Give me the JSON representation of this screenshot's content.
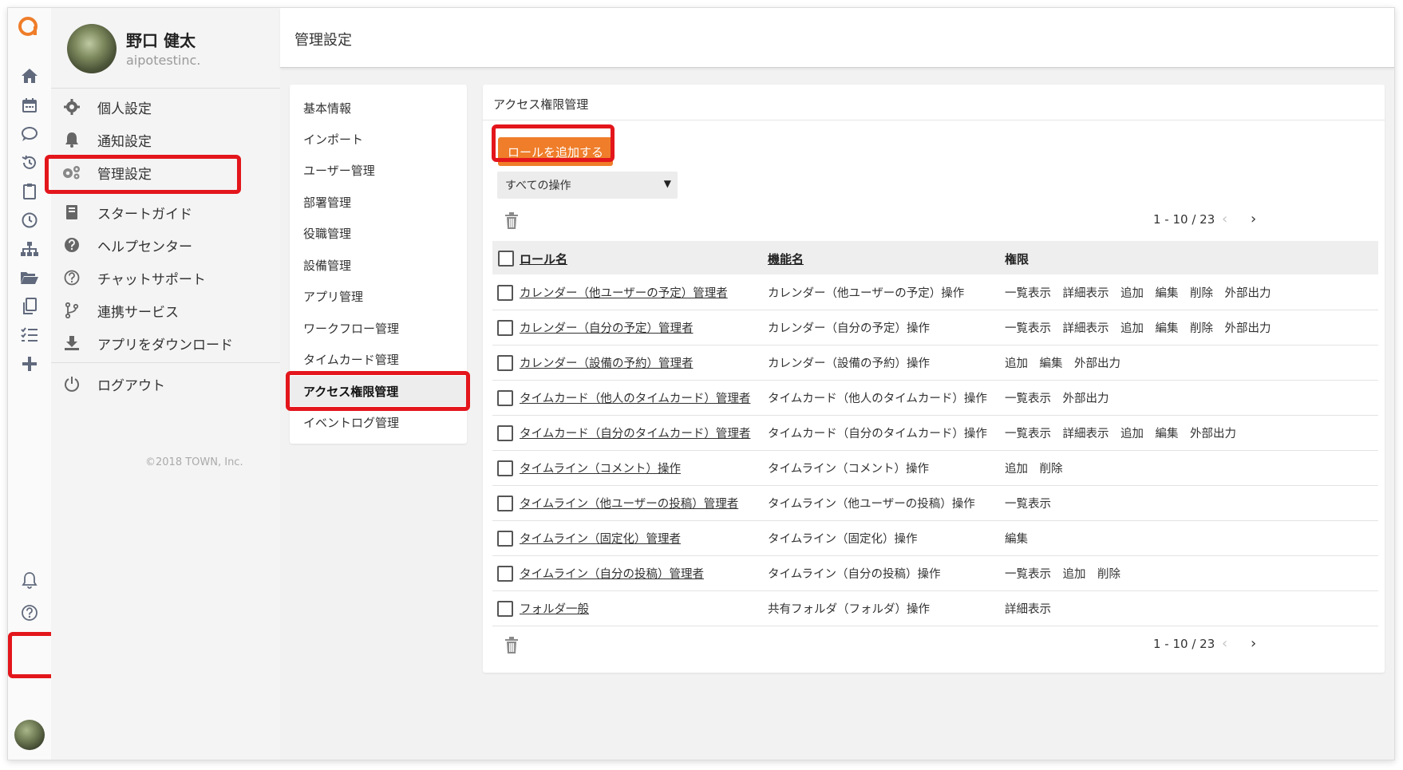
{
  "user": {
    "name": "野口 健太",
    "company": "aipotestinc."
  },
  "menu": [
    {
      "icon": "gear-icon",
      "label": "個人設定"
    },
    {
      "icon": "bell-icon",
      "label": "通知設定"
    },
    {
      "icon": "gears-icon",
      "label": "管理設定"
    },
    {
      "icon": "book-icon",
      "label": "スタートガイド"
    },
    {
      "icon": "question-circle-icon",
      "label": "ヘルプセンター"
    },
    {
      "icon": "question-outline-icon",
      "label": "チャットサポート"
    },
    {
      "icon": "branch-icon",
      "label": "連携サービス"
    },
    {
      "icon": "download-icon",
      "label": "アプリをダウンロード"
    },
    {
      "icon": "power-icon",
      "label": "ログアウト"
    }
  ],
  "copyright": "©2018 TOWN, Inc.",
  "header": {
    "title": "管理設定"
  },
  "settings_nav": [
    "基本情報",
    "インポート",
    "ユーザー管理",
    "部署管理",
    "役職管理",
    "設備管理",
    "アプリ管理",
    "ワークフロー管理",
    "タイムカード管理",
    "アクセス権限管理",
    "イベントログ管理"
  ],
  "settings_nav_active": "アクセス権限管理",
  "panel": {
    "title": "アクセス権限管理",
    "add_button": "ロールを追加する",
    "filter_selected": "すべての操作",
    "pagination": "1 - 10 / 23",
    "columns": {
      "role": "ロール名",
      "function": "機能名",
      "permission": "権限"
    },
    "rows": [
      {
        "role": "カレンダー（他ユーザーの予定）管理者",
        "function": "カレンダー（他ユーザーの予定）操作",
        "permission": "一覧表示　詳細表示　追加　編集　削除　外部出力"
      },
      {
        "role": "カレンダー（自分の予定）管理者",
        "function": "カレンダー（自分の予定）操作",
        "permission": "一覧表示　詳細表示　追加　編集　削除　外部出力"
      },
      {
        "role": "カレンダー（設備の予約）管理者",
        "function": "カレンダー（設備の予約）操作",
        "permission": "追加　編集　外部出力"
      },
      {
        "role": "タイムカード（他人のタイムカード）管理者",
        "function": "タイムカード（他人のタイムカード）操作",
        "permission": "一覧表示　外部出力"
      },
      {
        "role": "タイムカード（自分のタイムカード）管理者",
        "function": "タイムカード（自分のタイムカード）操作",
        "permission": "一覧表示　詳細表示　追加　編集　外部出力"
      },
      {
        "role": "タイムライン（コメント）操作",
        "function": "タイムライン（コメント）操作",
        "permission": "追加　削除"
      },
      {
        "role": "タイムライン（他ユーザーの投稿）管理者",
        "function": "タイムライン（他ユーザーの投稿）操作",
        "permission": "一覧表示"
      },
      {
        "role": "タイムライン（固定化）管理者",
        "function": "タイムライン（固定化）操作",
        "permission": "編集"
      },
      {
        "role": "タイムライン（自分の投稿）管理者",
        "function": "タイムライン（自分の投稿）操作",
        "permission": "一覧表示　追加　削除"
      },
      {
        "role": "フォルダ一般",
        "function": "共有フォルダ（フォルダ）操作",
        "permission": "詳細表示"
      }
    ]
  },
  "colors": {
    "accent": "#ef7d2a",
    "highlight": "#e3161c",
    "icon": "#616a7d"
  }
}
